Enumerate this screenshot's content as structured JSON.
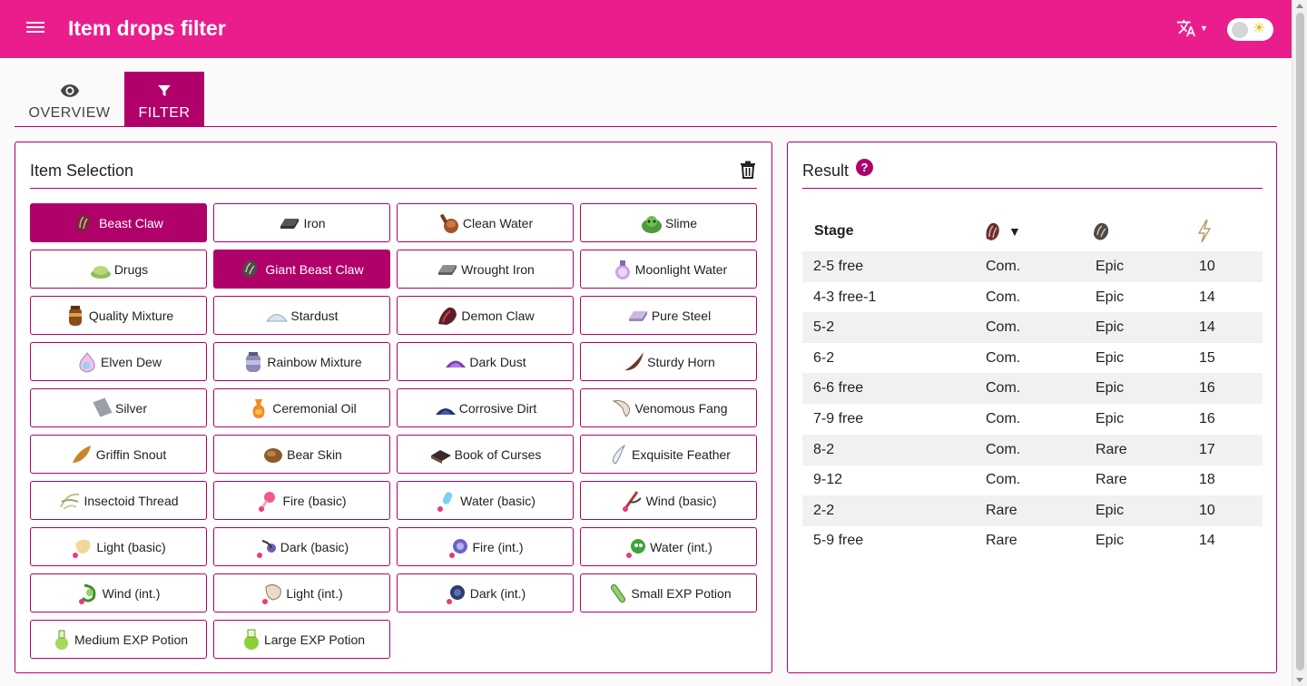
{
  "app": {
    "title": "Item drops filter"
  },
  "tabs": [
    {
      "label": "OVERVIEW",
      "icon": "eye-icon"
    },
    {
      "label": "FILTER",
      "icon": "filter-icon"
    }
  ],
  "item_selection": {
    "title": "Item Selection",
    "items": [
      {
        "label": "Beast Claw",
        "icon": "beast-claw-icon",
        "selected": true
      },
      {
        "label": "Iron",
        "icon": "iron-icon",
        "selected": false
      },
      {
        "label": "Clean Water",
        "icon": "clean-water-icon",
        "selected": false
      },
      {
        "label": "Slime",
        "icon": "slime-icon",
        "selected": false
      },
      {
        "label": "Drugs",
        "icon": "drugs-icon",
        "selected": false
      },
      {
        "label": "Giant Beast Claw",
        "icon": "giant-beast-claw-icon",
        "selected": true
      },
      {
        "label": "Wrought Iron",
        "icon": "wrought-iron-icon",
        "selected": false
      },
      {
        "label": "Moonlight Water",
        "icon": "moonlight-water-icon",
        "selected": false
      },
      {
        "label": "Quality Mixture",
        "icon": "quality-mixture-icon",
        "selected": false
      },
      {
        "label": "Stardust",
        "icon": "stardust-icon",
        "selected": false
      },
      {
        "label": "Demon Claw",
        "icon": "demon-claw-icon",
        "selected": false
      },
      {
        "label": "Pure Steel",
        "icon": "pure-steel-icon",
        "selected": false
      },
      {
        "label": "Elven Dew",
        "icon": "elven-dew-icon",
        "selected": false
      },
      {
        "label": "Rainbow Mixture",
        "icon": "rainbow-mixture-icon",
        "selected": false
      },
      {
        "label": "Dark Dust",
        "icon": "dark-dust-icon",
        "selected": false
      },
      {
        "label": "Sturdy Horn",
        "icon": "sturdy-horn-icon",
        "selected": false
      },
      {
        "label": "Silver",
        "icon": "silver-icon",
        "selected": false
      },
      {
        "label": "Ceremonial Oil",
        "icon": "ceremonial-oil-icon",
        "selected": false
      },
      {
        "label": "Corrosive Dirt",
        "icon": "corrosive-dirt-icon",
        "selected": false
      },
      {
        "label": "Venomous Fang",
        "icon": "venomous-fang-icon",
        "selected": false
      },
      {
        "label": "Griffin Snout",
        "icon": "griffin-snout-icon",
        "selected": false
      },
      {
        "label": "Bear Skin",
        "icon": "bear-skin-icon",
        "selected": false
      },
      {
        "label": "Book of Curses",
        "icon": "book-of-curses-icon",
        "selected": false
      },
      {
        "label": "Exquisite Feather",
        "icon": "exquisite-feather-icon",
        "selected": false
      },
      {
        "label": "Insectoid Thread",
        "icon": "insectoid-thread-icon",
        "selected": false
      },
      {
        "label": "Fire (basic)",
        "icon": "fire-basic-icon",
        "selected": false
      },
      {
        "label": "Water (basic)",
        "icon": "water-basic-icon",
        "selected": false
      },
      {
        "label": "Wind (basic)",
        "icon": "wind-basic-icon",
        "selected": false
      },
      {
        "label": "Light (basic)",
        "icon": "light-basic-icon",
        "selected": false
      },
      {
        "label": "Dark (basic)",
        "icon": "dark-basic-icon",
        "selected": false
      },
      {
        "label": "Fire (int.)",
        "icon": "fire-int-icon",
        "selected": false
      },
      {
        "label": "Water (int.)",
        "icon": "water-int-icon",
        "selected": false
      },
      {
        "label": "Wind (int.)",
        "icon": "wind-int-icon",
        "selected": false
      },
      {
        "label": "Light (int.)",
        "icon": "light-int-icon",
        "selected": false
      },
      {
        "label": "Dark (int.)",
        "icon": "dark-int-icon",
        "selected": false
      },
      {
        "label": "Small EXP Potion",
        "icon": "small-exp-potion-icon",
        "selected": false
      },
      {
        "label": "Medium EXP Potion",
        "icon": "medium-exp-potion-icon",
        "selected": false
      },
      {
        "label": "Large EXP Potion",
        "icon": "large-exp-potion-icon",
        "selected": false
      }
    ]
  },
  "result": {
    "title": "Result",
    "columns": [
      {
        "label": "Stage"
      },
      {
        "label": "",
        "icon": "beast-claw-icon",
        "sort": "▼"
      },
      {
        "label": "",
        "icon": "giant-beast-claw-icon"
      },
      {
        "label": "",
        "icon": "energy-icon"
      }
    ],
    "rows": [
      [
        "2-5 free",
        "Com.",
        "Epic",
        "10"
      ],
      [
        "4-3 free-1",
        "Com.",
        "Epic",
        "14"
      ],
      [
        "5-2",
        "Com.",
        "Epic",
        "14"
      ],
      [
        "6-2",
        "Com.",
        "Epic",
        "15"
      ],
      [
        "6-6 free",
        "Com.",
        "Epic",
        "16"
      ],
      [
        "7-9 free",
        "Com.",
        "Epic",
        "16"
      ],
      [
        "8-2",
        "Com.",
        "Rare",
        "17"
      ],
      [
        "9-12",
        "Com.",
        "Rare",
        "18"
      ],
      [
        "2-2",
        "Rare",
        "Epic",
        "10"
      ],
      [
        "5-9 free",
        "Rare",
        "Epic",
        "14"
      ]
    ]
  },
  "colors": {
    "appbar": "#e91e8c",
    "accent": "#b0006a"
  }
}
